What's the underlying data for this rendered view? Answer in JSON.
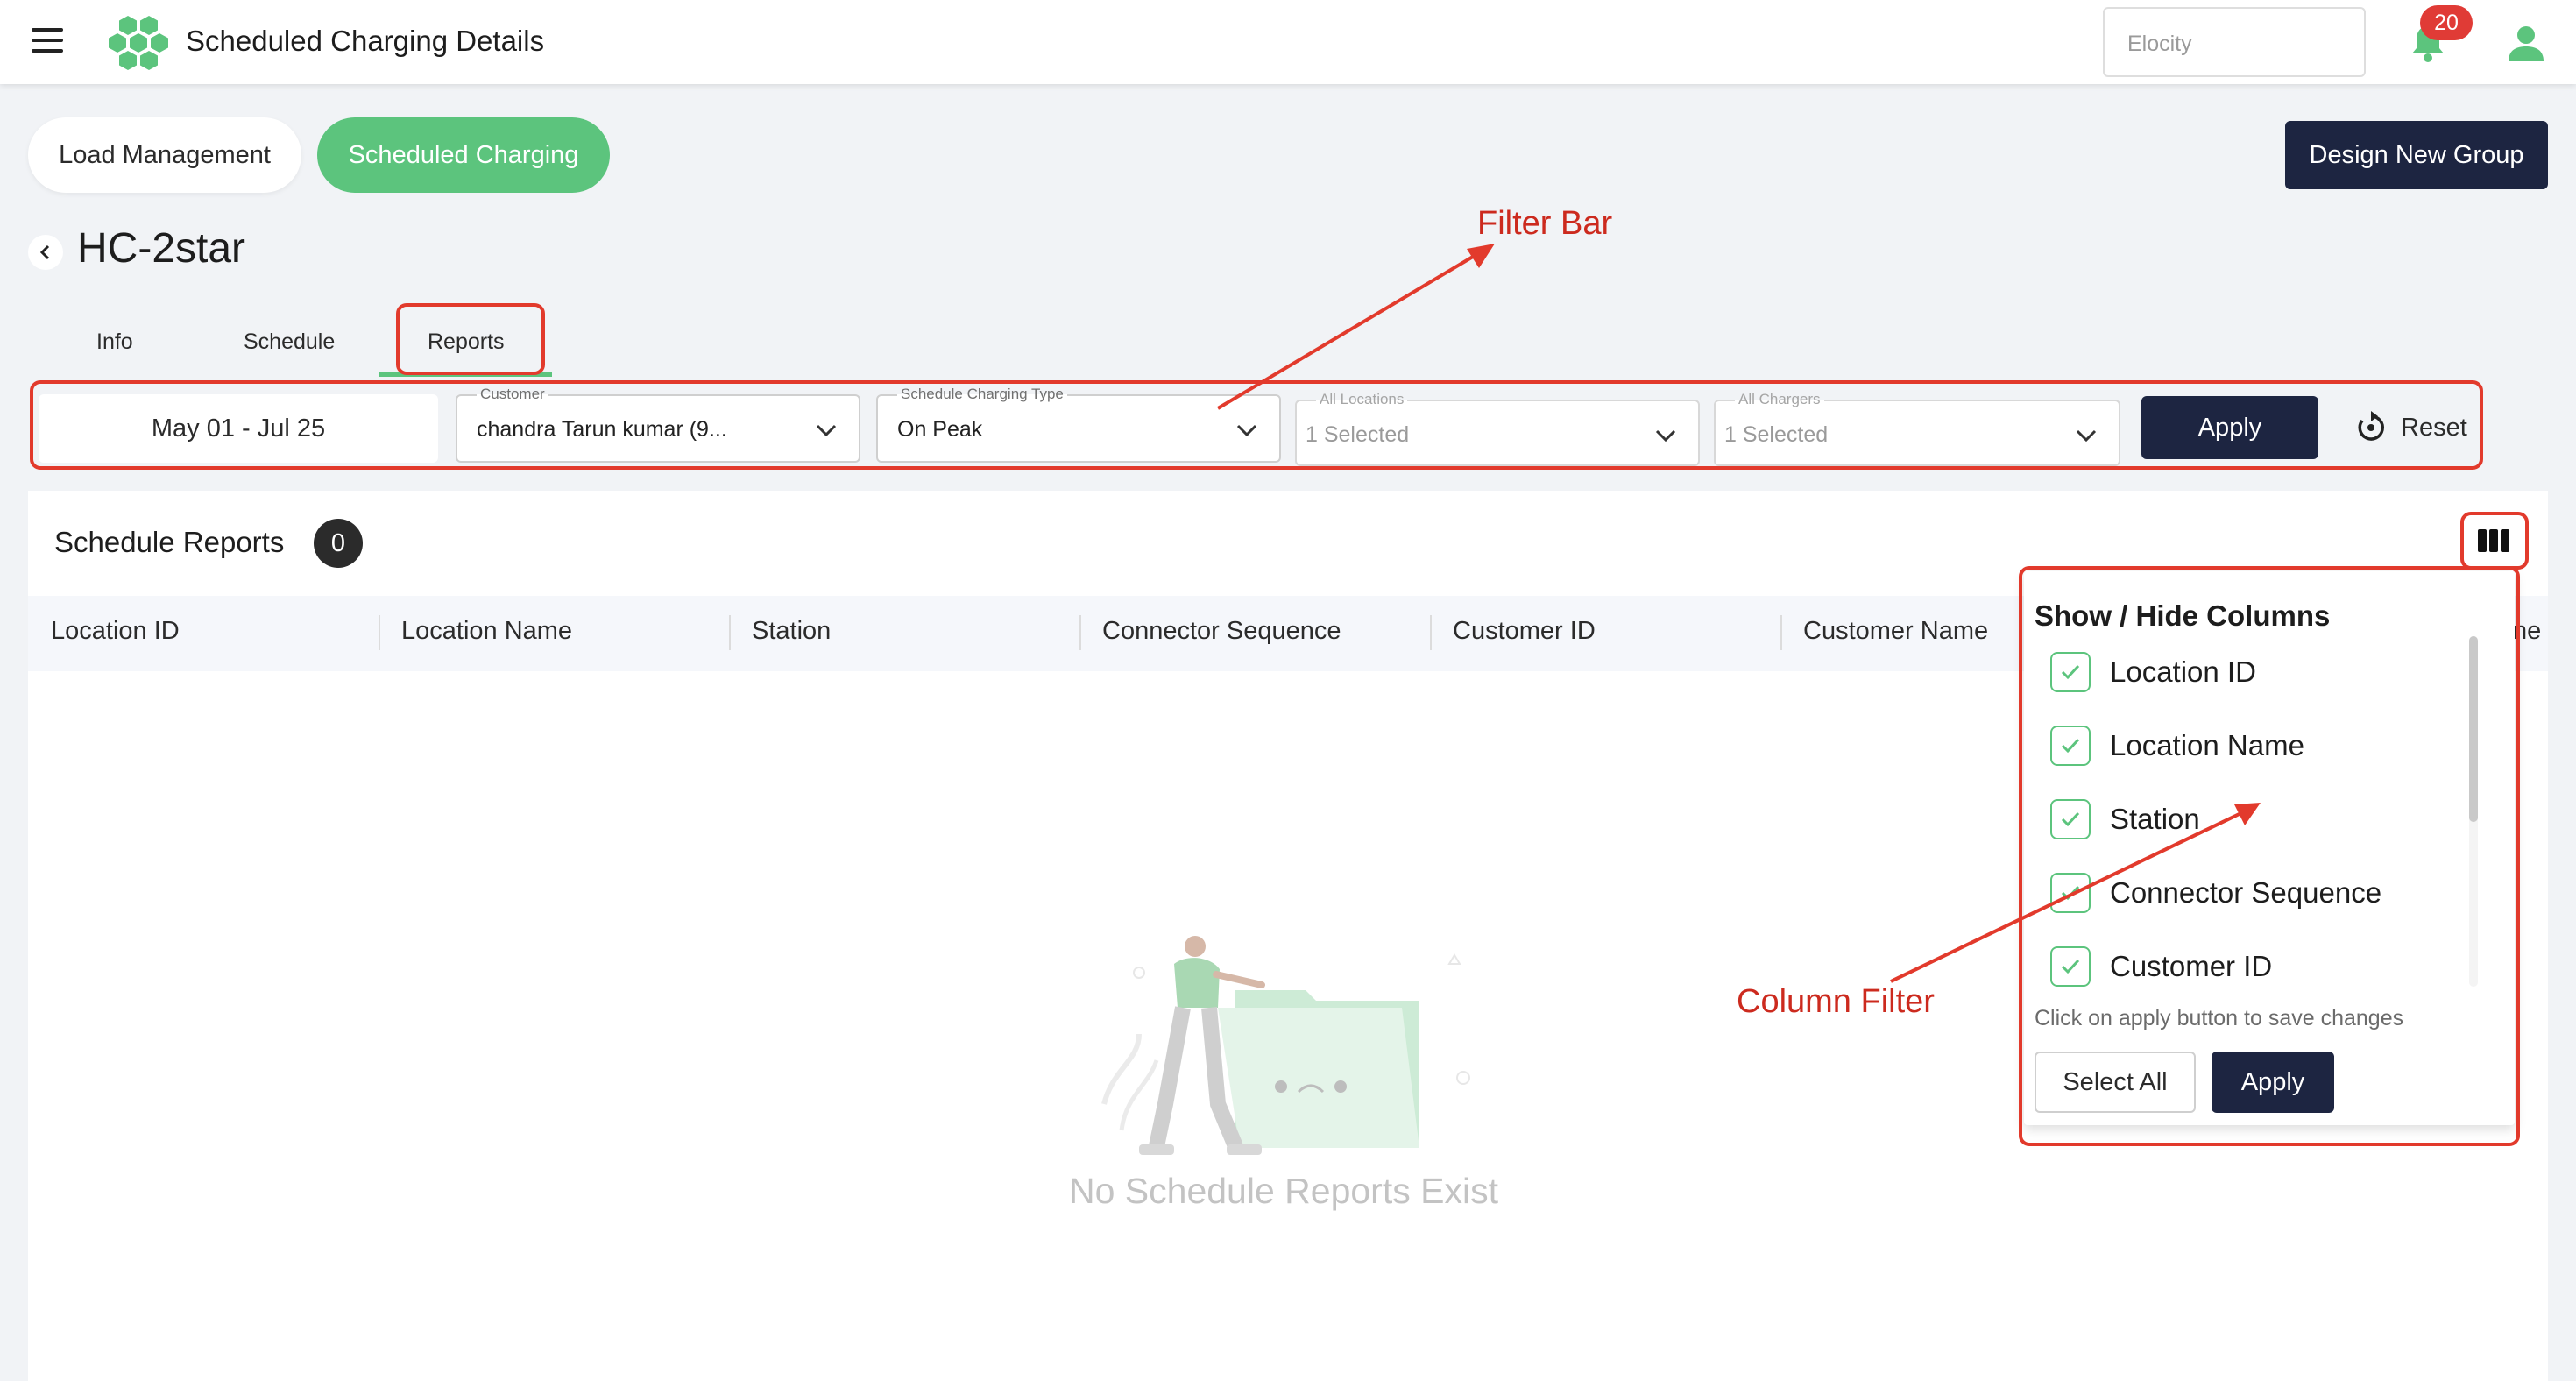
{
  "header": {
    "app_title": "Scheduled Charging Details",
    "org_placeholder": "Elocity",
    "notification_count": "20"
  },
  "top_tabs": {
    "load_management": "Load Management",
    "scheduled_charging": "Scheduled Charging",
    "design_new_group": "Design New Group"
  },
  "page_title": "HC-2star",
  "sub_tabs": {
    "info": "Info",
    "schedule": "Schedule",
    "reports": "Reports"
  },
  "filters": {
    "date_range": "May 01 - Jul 25",
    "customer": {
      "label": "Customer",
      "value": "chandra Tarun kumar (9..."
    },
    "charging_type": {
      "label": "Schedule Charging Type",
      "value": "On Peak"
    },
    "locations": {
      "label": "All Locations",
      "value": "1 Selected"
    },
    "chargers": {
      "label": "All Chargers",
      "value": "1 Selected"
    },
    "apply": "Apply",
    "reset": "Reset"
  },
  "reports": {
    "title": "Schedule Reports",
    "count": "0",
    "columns": [
      "Location ID",
      "Location Name",
      "Station",
      "Connector Sequence",
      "Customer ID",
      "Customer Name"
    ],
    "overflow_column_fragment": "ne",
    "empty_text": "No Schedule Reports Exist"
  },
  "column_filter": {
    "title": "Show / Hide Columns",
    "items": [
      "Location ID",
      "Location Name",
      "Station",
      "Connector Sequence",
      "Customer ID"
    ],
    "hint": "Click on apply button to save changes",
    "select_all": "Select All",
    "apply": "Apply"
  },
  "annotations": {
    "filter_bar": "Filter Bar",
    "column_filter": "Column Filter"
  },
  "colors": {
    "accent_green": "#5cc47d",
    "navy": "#1d2541",
    "badge_red": "#e03b36",
    "annotation_red": "#e23a2c"
  }
}
